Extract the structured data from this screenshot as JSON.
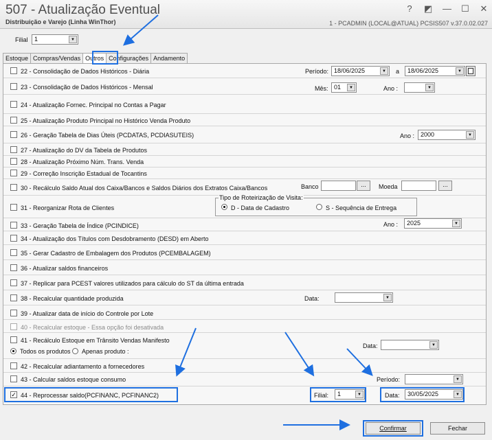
{
  "window": {
    "title": "507 - Atualização Eventual",
    "subtitle": "Distribuição e Varejo (Linha WinThor)",
    "info": "1 - PCADMIN (LOCAL@ATUAL)   PCSIS507  v.37.0.02.027",
    "buttons": [
      "?",
      "◩",
      "—",
      "☐",
      "✕"
    ]
  },
  "filial_top": {
    "label": "Filial",
    "value": "1"
  },
  "tabs": [
    "Estoque",
    "Compras/Vendas",
    "Outros",
    "Configurações",
    "Andamento"
  ],
  "active_tab": "Outros",
  "options": [
    {
      "label": "22 - Consolidação de Dados Históricos - Diária",
      "checked": false
    },
    {
      "label": "23 - Consolidação de Dados Históricos - Mensal",
      "checked": false
    },
    {
      "label": "24 - Atualização Fornec. Principal no Contas a Pagar",
      "checked": false
    },
    {
      "label": "25 - Atualização Produto Principal no Histórico Venda Produto",
      "checked": false
    },
    {
      "label": "26 - Geração Tabela de Dias Úteis (PCDATAS, PCDIASUTEIS)",
      "checked": false
    },
    {
      "label": "27 - Atualização do DV da Tabela de Produtos",
      "checked": false
    },
    {
      "label": "28 - Atualização Próximo Núm. Trans. Venda",
      "checked": false
    },
    {
      "label": "29 - Correção Inscrição Estadual de Tocantins",
      "checked": false
    },
    {
      "label": "30 - Recálculo Saldo Atual dos Caixa/Bancos e Saldos Diários dos Extratos Caixa/Bancos",
      "checked": false
    },
    {
      "label": "31 - Reorganizar Rota de Clientes",
      "checked": false
    },
    {
      "label": "33 - Geração Tabela de Índice (PCINDICE)",
      "checked": false
    },
    {
      "label": "34 - Atualização dos Títulos com Desdobramento (DESD) em Aberto",
      "checked": false
    },
    {
      "label": "35 - Gerar Cadastro de Embalagem dos Produtos (PCEMBALAGEM)",
      "checked": false
    },
    {
      "label": "36 - Atualizar saldos financeiros",
      "checked": false
    },
    {
      "label": "37 - Replicar para PCEST valores utilizados para cálculo do ST da última entrada",
      "checked": false
    },
    {
      "label": "38 - Recalcular quantidade produzida",
      "checked": false
    },
    {
      "label": "39 - Atualizar data de início do Controle por Lote",
      "checked": false
    },
    {
      "label": "40 - Recalcular estoque - Essa opção foi desativada",
      "checked": false
    },
    {
      "label": "41 - Recálculo Estoque em Trânsito Vendas Manifesto",
      "checked": false
    },
    {
      "label": "42 - Recalcular adiantamento a fornecedores",
      "checked": false
    },
    {
      "label": "43 - Calcular saldos estoque consumo",
      "checked": false
    },
    {
      "label": "44 - Reprocessar saldo(PCFINANC, PCFINANC2)",
      "checked": true
    }
  ],
  "fields": {
    "periodo_label": "Período:",
    "periodo_from": "18/06/2025",
    "periodo_a": "a",
    "periodo_to": "18/06/2025",
    "mes_label": "Mês:",
    "mes_value": "01",
    "ano_label": "Ano :",
    "ano23_value": "",
    "ano26_label": "Ano :",
    "ano26_value": "2000",
    "banco_label": "Banco",
    "moeda_label": "Moeda",
    "ellipsis": "...",
    "rot_group_title": "Tipo de Roteirização de Visita:",
    "rot_opt1": "D - Data de Cadastro",
    "rot_opt2": "S - Sequência de Entrega",
    "ano33_label": "Ano :",
    "ano33_value": "2025",
    "data38_label": "Data:",
    "data41_label": "Data:",
    "radio41_opt1": "Todos os produtos",
    "radio41_opt2": "Apenas produto :",
    "periodo43_label": "Período:",
    "filial44_label": "Filial:",
    "filial44_value": "1",
    "data44_label": "Data:",
    "data44_value": "30/05/2025"
  },
  "actions": {
    "confirm": "Confirmar",
    "close": "Fechar"
  },
  "colors": {
    "highlight": "#1e6fe0",
    "disabled_text": "#8a8a8a"
  }
}
